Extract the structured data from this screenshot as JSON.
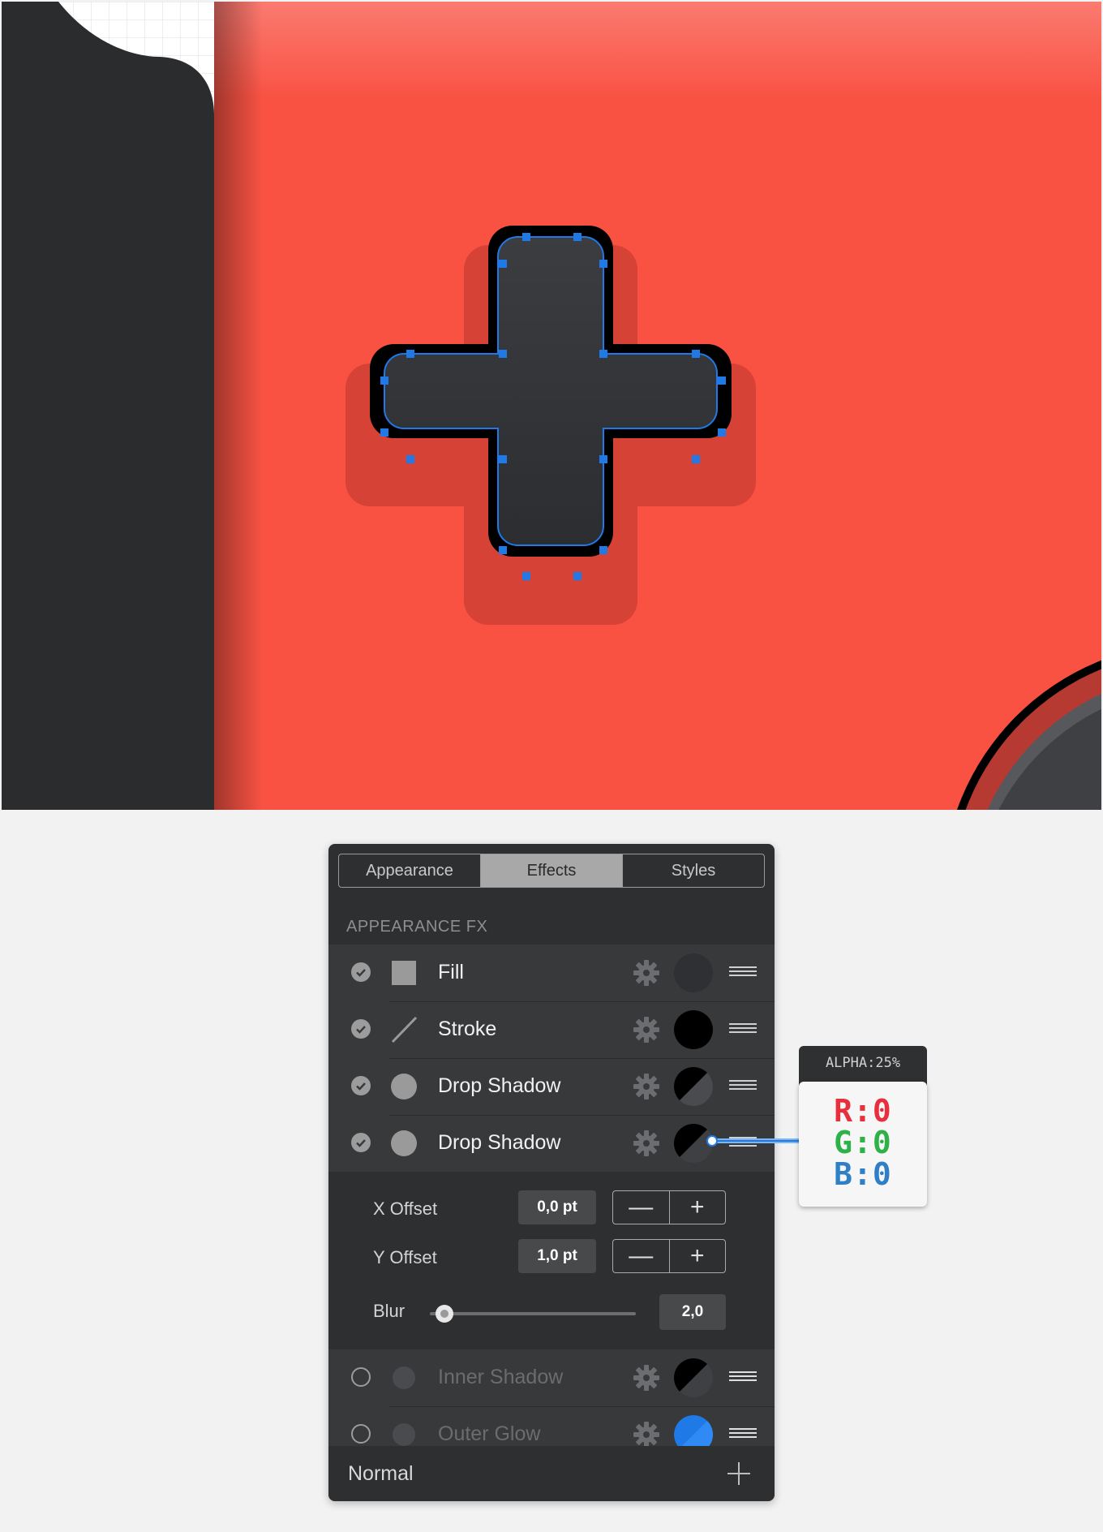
{
  "canvas": {
    "background_color": "#f95243",
    "shape_fill": "#34363a",
    "shape_stroke": "#000000",
    "selection_color": "#1f7ae8"
  },
  "panel": {
    "tabs": [
      {
        "label": "Appearance",
        "active": false
      },
      {
        "label": "Effects",
        "active": true
      },
      {
        "label": "Styles",
        "active": false
      }
    ],
    "section_label": "APPEARANCE FX",
    "effects": [
      {
        "label": "Fill",
        "enabled": true,
        "type_icon": "square-icon",
        "swatch": "dark-gray-circle"
      },
      {
        "label": "Stroke",
        "enabled": true,
        "type_icon": "line-icon",
        "swatch": "black-circle"
      },
      {
        "label": "Drop Shadow",
        "enabled": true,
        "type_icon": "circle-icon",
        "swatch": "black-split-circle"
      },
      {
        "label": "Drop Shadow",
        "enabled": true,
        "type_icon": "circle-icon",
        "swatch": "black-split-circle"
      },
      {
        "label": "Inner Shadow",
        "enabled": false,
        "type_icon": "circle-icon",
        "swatch": "black-split-circle"
      },
      {
        "label": "Outer Glow",
        "enabled": false,
        "type_icon": "circle-icon",
        "swatch": "blue-split-circle"
      }
    ],
    "details": {
      "x_offset_label": "X Offset",
      "x_offset_value": "0,0 pt",
      "y_offset_label": "Y Offset",
      "y_offset_value": "1,0 pt",
      "blur_label": "Blur",
      "blur_value": "2,0",
      "minus": "—",
      "plus": "+"
    },
    "blend_mode": "Normal"
  },
  "callout": {
    "alpha": "ALPHA:25%",
    "r": "R:0",
    "g": "G:0",
    "b": "B:0",
    "colors": {
      "r": "#e8303c",
      "g": "#2fb14a",
      "b": "#2f7fc6"
    }
  }
}
